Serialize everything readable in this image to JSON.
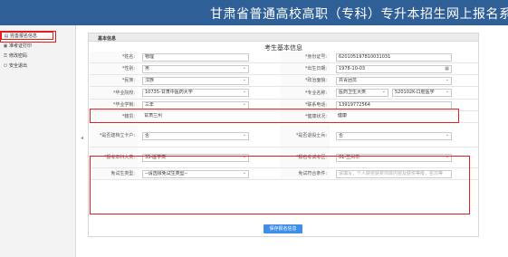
{
  "banner": {
    "title": "甘肃省普通高校高职（专科）专升本招生网上报名系"
  },
  "sidebar": {
    "items": [
      {
        "label": "完善报名信息",
        "icon": "document-icon"
      },
      {
        "label": "准考证打印",
        "icon": "print-icon"
      },
      {
        "label": "修改密码",
        "icon": "key-icon"
      },
      {
        "label": "安全退出",
        "icon": "power-icon"
      }
    ]
  },
  "section": {
    "title": "基本信息"
  },
  "form": {
    "title": "考生基本信息",
    "name_label": "*姓名:",
    "name_value": "物理",
    "id_label": "*身份证号:",
    "id_value": "620105197810031031",
    "gender_label": "*性别:",
    "gender_value": "男",
    "birth_label": "*出生日期:",
    "birth_value": "1978-10-03",
    "ethnic_label": "*民族:",
    "ethnic_value": "汉族",
    "political_label": "*政治面貌:",
    "political_value": "共青团员",
    "school_label": "*毕业院校:",
    "school_value": "10735-甘肃中医药大学",
    "major_label": "*专业名称:",
    "major_cat_value": "医药卫生大类",
    "major_value": "520102K-口腔医学",
    "system_label": "*毕业学制:",
    "system_value": "三年",
    "phone_label": "*联系电话:",
    "phone_value": "13919772564",
    "origin_label": "*籍贯:",
    "origin_value": "甘肃兰州",
    "health_label": "*健康状况:",
    "health_value": "健康",
    "card_label": "*是否建档立卡户:",
    "card_value": "否",
    "veteran_label": "*是否退役士兵:",
    "veteran_value": "否",
    "subject_label": "*报考本科大类:",
    "subject_value": "35-医学类",
    "exam_area_label": "*报名考试考区:",
    "exam_area_value": "01-兰州市",
    "exempt_type_label": "免试生类型:",
    "exempt_type_placeholder": "--请选择免试生类型--",
    "exempt_cond_label": "免试符合条件:",
    "exempt_cond_placeholder": "请填写，个人获奖获奖项目内容及获奖等级，名次等"
  },
  "actions": {
    "save_label": "保存报名信息"
  },
  "colors": {
    "banner": "#2f5f97",
    "highlight": "#e02020",
    "button": "#3f8ee9"
  }
}
